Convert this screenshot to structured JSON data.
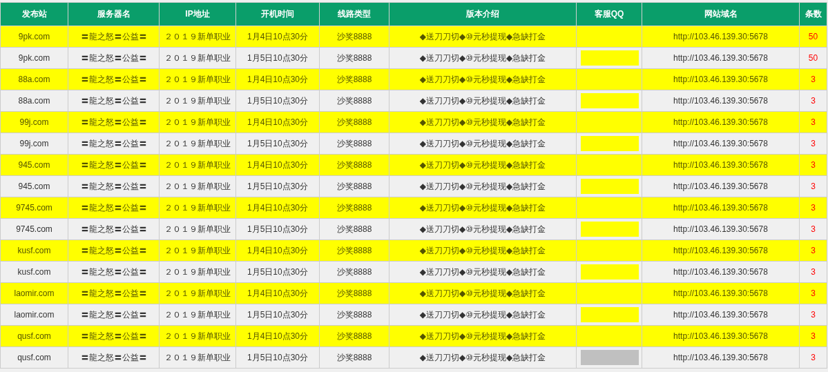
{
  "table": {
    "columns": [
      "发布站",
      "服务器名",
      "IP地址",
      "开机时间",
      "线路类型",
      "版本介绍",
      "客服QQ",
      "网站域名",
      "条数"
    ],
    "rows": [
      {
        "highlighted": true,
        "cells": [
          "9pk.com",
          "〓龍之怒〓公益〓",
          "２０１９新单职业",
          "1月4日10点30分",
          "沙奖8888",
          "◆送刀刀切◆⑩元秒提现◆急缺打金",
          "",
          "http://103.46.139.30:5678",
          "50"
        ]
      },
      {
        "highlighted": false,
        "color": "#ffff00",
        "cells": [
          "9pk.com",
          "〓龍之怒〓公益〓",
          "２０１９新单职业",
          "1月5日10点30分",
          "沙奖8888",
          "◆送刀刀切◆⑩元秒提现◆急缺打金",
          "",
          "http://103.46.139.30:5678",
          "50"
        ]
      },
      {
        "highlighted": true,
        "cells": [
          "88a.com",
          "〓龍之怒〓公益〓",
          "２０１９新单职业",
          "1月4日10点30分",
          "沙奖8888",
          "◆送刀刀切◆⑩元秒提现◆急缺打金",
          "",
          "http://103.46.139.30:5678",
          "3"
        ]
      },
      {
        "highlighted": false,
        "color": "#ffff00",
        "cells": [
          "88a.com",
          "〓龍之怒〓公益〓",
          "２０１９新单职业",
          "1月5日10点30分",
          "沙奖8888",
          "◆送刀刀切◆⑩元秒提现◆急缺打金",
          "",
          "http://103.46.139.30:5678",
          "3"
        ]
      },
      {
        "highlighted": true,
        "cells": [
          "99j.com",
          "〓龍之怒〓公益〓",
          "２０１９新单职业",
          "1月4日10点30分",
          "沙奖8888",
          "◆送刀刀切◆⑩元秒提现◆急缺打金",
          "",
          "http://103.46.139.30:5678",
          "3"
        ]
      },
      {
        "highlighted": false,
        "color": "#ffff00",
        "cells": [
          "99j.com",
          "〓龍之怒〓公益〓",
          "２０１９新单职业",
          "1月5日10点30分",
          "沙奖8888",
          "◆送刀刀切◆⑩元秒提现◆急缺打金",
          "",
          "http://103.46.139.30:5678",
          "3"
        ]
      },
      {
        "highlighted": true,
        "cells": [
          "945.com",
          "〓龍之怒〓公益〓",
          "２０１９新单职业",
          "1月4日10点30分",
          "沙奖8888",
          "◆送刀刀切◆⑩元秒提现◆急缺打金",
          "",
          "http://103.46.139.30:5678",
          "3"
        ]
      },
      {
        "highlighted": false,
        "color": "#ffff00",
        "cells": [
          "945.com",
          "〓龍之怒〓公益〓",
          "２０１９新单职业",
          "1月5日10点30分",
          "沙奖8888",
          "◆送刀刀切◆⑩元秒提现◆急缺打金",
          "",
          "http://103.46.139.30:5678",
          "3"
        ]
      },
      {
        "highlighted": true,
        "cells": [
          "9745.com",
          "〓龍之怒〓公益〓",
          "２０１９新单职业",
          "1月4日10点30分",
          "沙奖8888",
          "◆送刀刀切◆⑩元秒提现◆急缺打金",
          "",
          "http://103.46.139.30:5678",
          "3"
        ]
      },
      {
        "highlighted": false,
        "color": "#ffff00",
        "cells": [
          "9745.com",
          "〓龍之怒〓公益〓",
          "２０１９新单职业",
          "1月5日10点30分",
          "沙奖8888",
          "◆送刀刀切◆⑩元秒提现◆急缺打金",
          "",
          "http://103.46.139.30:5678",
          "3"
        ]
      },
      {
        "highlighted": true,
        "cells": [
          "kusf.com",
          "〓龍之怒〓公益〓",
          "２０１９新单职业",
          "1月4日10点30分",
          "沙奖8888",
          "◆送刀刀切◆⑩元秒提现◆急缺打金",
          "",
          "http://103.46.139.30:5678",
          "3"
        ]
      },
      {
        "highlighted": false,
        "color": "#ffff00",
        "cells": [
          "kusf.com",
          "〓龍之怒〓公益〓",
          "２０１９新单职业",
          "1月5日10点30分",
          "沙奖8888",
          "◆送刀刀切◆⑩元秒提现◆急缺打金",
          "",
          "http://103.46.139.30:5678",
          "3"
        ]
      },
      {
        "highlighted": true,
        "cells": [
          "laomir.com",
          "〓龍之怒〓公益〓",
          "２０１９新单职业",
          "1月4日10点30分",
          "沙奖8888",
          "◆送刀刀切◆⑩元秒提现◆急缺打金",
          "",
          "http://103.46.139.30:5678",
          "3"
        ]
      },
      {
        "highlighted": false,
        "color": "#ffff00",
        "cells": [
          "laomir.com",
          "〓龍之怒〓公益〓",
          "２０１９新单职业",
          "1月5日10点30分",
          "沙奖8888",
          "◆送刀刀切◆⑩元秒提现◆急缺打金",
          "",
          "http://103.46.139.30:5678",
          "3"
        ]
      },
      {
        "highlighted": true,
        "cells": [
          "qusf.com",
          "〓龍之怒〓公益〓",
          "２０１９新单职业",
          "1月4日10点30分",
          "沙奖8888",
          "◆送刀刀切◆⑩元秒提现◆急缺打金",
          "",
          "http://103.46.139.30:5678",
          "3"
        ]
      },
      {
        "highlighted": false,
        "color": "#c0c0c0",
        "cells": [
          "qusf.com",
          "〓龍之怒〓公益〓",
          "２０１９新单职业",
          "1月5日10点30分",
          "沙奖8888",
          "◆送刀刀切◆⑩元秒提现◆急缺打金",
          "",
          "http://103.46.139.30:5678",
          "3"
        ]
      }
    ]
  }
}
